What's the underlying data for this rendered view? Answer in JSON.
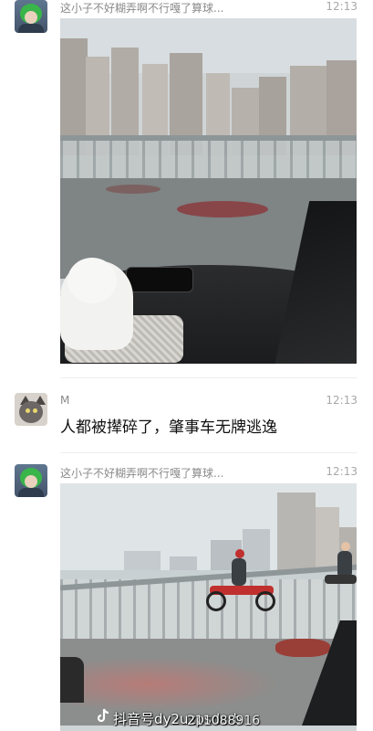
{
  "messages": [
    {
      "sender": "这小子不好糊弄啊不行嘎了算球...",
      "time": "12:13",
      "type": "image"
    },
    {
      "sender": "M",
      "time": "12:13",
      "type": "text",
      "text": "人都被撵碎了，肇事车无牌逃逸"
    },
    {
      "sender": "这小子不好糊弄啊不行嘎了算球...",
      "time": "12:13",
      "type": "image"
    }
  ],
  "watermark": {
    "text": "抖音号dy2uzpsdcrb",
    "overlap_text": "211088916"
  },
  "icons": {
    "avatar_1": "green-hair-avatar",
    "avatar_2": "cat-avatar",
    "watermark": "tiktok-icon"
  }
}
